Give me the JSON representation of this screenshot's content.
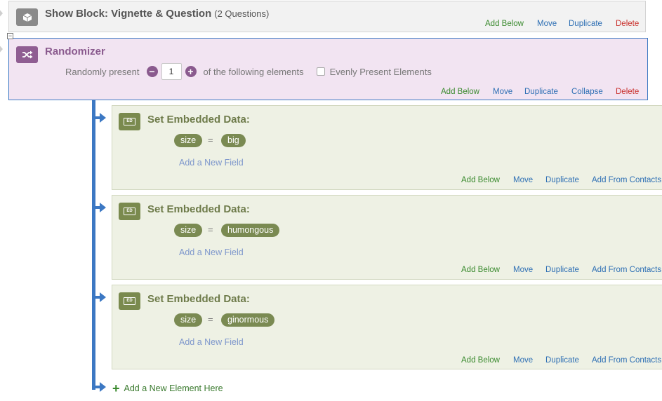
{
  "show_block": {
    "title": "Show Block: Vignette & Question",
    "subtitle": "(2 Questions)",
    "actions": {
      "add_below": "Add Below",
      "move": "Move",
      "duplicate": "Duplicate",
      "delete": "Delete"
    }
  },
  "randomizer": {
    "title": "Randomizer",
    "prefix": "Randomly present",
    "count": "1",
    "suffix": "of the following elements",
    "evenly_label": "Evenly Present Elements",
    "evenly_checked": false,
    "actions": {
      "add_below": "Add Below",
      "move": "Move",
      "duplicate": "Duplicate",
      "collapse": "Collapse",
      "delete": "Delete"
    }
  },
  "embedded_blocks": [
    {
      "title": "Set Embedded Data:",
      "icon_text": "ED",
      "field": "size",
      "op": "=",
      "value": "big",
      "add_field": "Add a New Field",
      "actions": {
        "add_below": "Add Below",
        "move": "Move",
        "duplicate": "Duplicate",
        "add_from_contacts": "Add From Contacts"
      }
    },
    {
      "title": "Set Embedded Data:",
      "icon_text": "ED",
      "field": "size",
      "op": "=",
      "value": "humongous",
      "add_field": "Add a New Field",
      "actions": {
        "add_below": "Add Below",
        "move": "Move",
        "duplicate": "Duplicate",
        "add_from_contacts": "Add From Contacts"
      }
    },
    {
      "title": "Set Embedded Data:",
      "icon_text": "ED",
      "field": "size",
      "op": "=",
      "value": "ginormous",
      "add_field": "Add a New Field",
      "actions": {
        "add_below": "Add Below",
        "move": "Move",
        "duplicate": "Duplicate",
        "add_from_contacts": "Add From Contacts"
      }
    }
  ],
  "add_element": "Add a New Element Here",
  "colors": {
    "flow_line": "#3c78c3",
    "randomizer_bg": "#f2e4f2",
    "randomizer_accent": "#8a5a8e",
    "embedded_bg": "#eef1e4",
    "embedded_accent": "#7a8a52",
    "action_green": "#3a8a2e",
    "action_blue": "#2e6fb4",
    "action_red": "#c9302c"
  }
}
